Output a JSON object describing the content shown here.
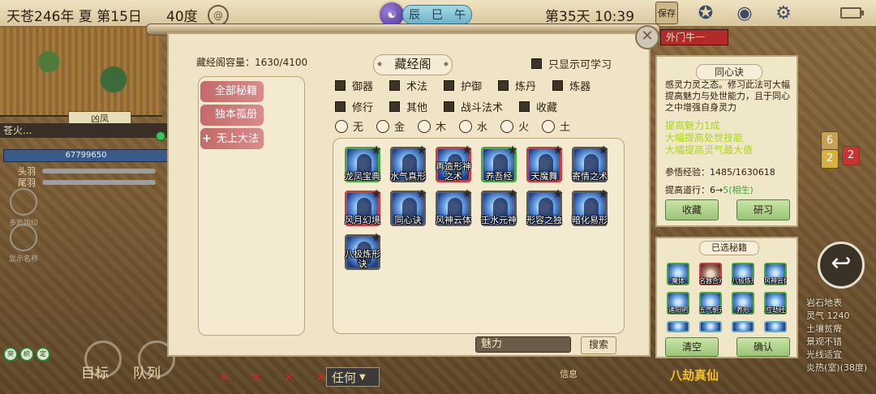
{
  "topbar": {
    "date": "天苍246年 夏 第15日",
    "temperature": "40度",
    "weather_icon": "spiral-wind-icon",
    "yin_yang": "☯",
    "time_band": [
      "辰",
      "巳",
      "午"
    ],
    "day_time": "第35天 10:39",
    "save_label": "保存"
  },
  "hud_left": {
    "unit_tag": "凶凤",
    "unit_name": "苍火...",
    "hp": "67799650",
    "rows": [
      "头羽",
      "尾羽"
    ],
    "ghosts": [
      "多恐指印",
      "显示名称"
    ],
    "badges": [
      "突",
      "织",
      "定"
    ],
    "bottom_buttons": [
      "目标",
      "队列"
    ],
    "filter_any": "任何",
    "info": "信息",
    "catastrophe": "八劫真仙",
    "outer_tag": "外门牛一"
  },
  "hud_right": {
    "terrain": [
      "岩石地表",
      "灵气 1240",
      "土壤贫瘠",
      "景观不错",
      "光线适宜",
      "炎热(室)(38度)"
    ],
    "pills": [
      "6",
      "2",
      "2"
    ]
  },
  "panel": {
    "capacity": "藏经阁容量：1630/4100",
    "title": "藏经阁",
    "only_learnable": "只显示可学习",
    "categories": [
      "全部秘籍",
      "独本孤册",
      "无上大法"
    ],
    "filter_row1": [
      "御器",
      "术法",
      "护御",
      "炼丹",
      "炼器"
    ],
    "filter_row2": [
      "修行",
      "其他",
      "战斗法术",
      "收藏"
    ],
    "elements": [
      "无",
      "金",
      "木",
      "水",
      "火",
      "土"
    ],
    "books": [
      {
        "name": "龙凤宝典",
        "frame": "green"
      },
      {
        "name": "水气真形",
        "frame": "plain"
      },
      {
        "name": "再造形神之术",
        "frame": "red"
      },
      {
        "name": "养吾经",
        "frame": "green"
      },
      {
        "name": "天魔舞",
        "frame": "red"
      },
      {
        "name": "寄情之术",
        "frame": "plain"
      },
      {
        "name": "风月幻境",
        "frame": "red"
      },
      {
        "name": "同心诀",
        "frame": "plain"
      },
      {
        "name": "风神云体",
        "frame": "plain"
      },
      {
        "name": "壬水元神",
        "frame": "plain"
      },
      {
        "name": "形容之独",
        "frame": "plain"
      },
      {
        "name": "暗化易形",
        "frame": "plain"
      },
      {
        "name": "八极炼形诀",
        "frame": "plain"
      }
    ],
    "search_value": "魅力",
    "search_button": "搜索"
  },
  "detail": {
    "title": "同心诀",
    "description": "感灵力灵之态。修习此法可大幅提高魅力与处世能力，且于同心之中增强自身灵力",
    "effects": [
      "提高魅力1成",
      "大幅提高处世技能",
      "大幅提高灵气最大值"
    ],
    "exp_label": "参悟经验：",
    "exp_value": "1485/1630618",
    "dao_label": "提高道行：",
    "dao_value": "6→",
    "dao_extra": "5(相生)",
    "collect_button": "收藏",
    "study_button": "研习"
  },
  "selected": {
    "title": "已选秘籍",
    "books": [
      "魔体",
      "名器合欢",
      "八极炼形",
      "风神云体",
      "诸阳明",
      "五气朝元",
      "养形",
      "应劫经",
      "",
      "",
      "",
      ""
    ],
    "clear_button": "清空",
    "confirm_button": "确认"
  }
}
